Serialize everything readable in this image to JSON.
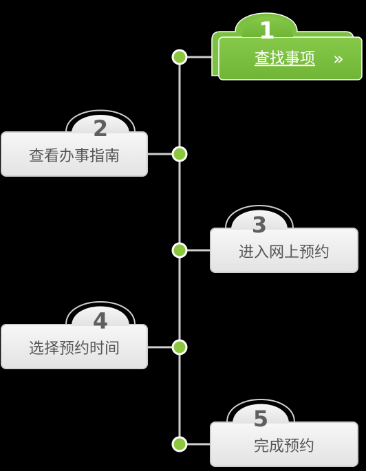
{
  "steps": [
    {
      "number": "1",
      "label": "查找事项",
      "active": true,
      "link": true,
      "arrow": "»"
    },
    {
      "number": "2",
      "label": "查看办事指南",
      "active": false
    },
    {
      "number": "3",
      "label": "进入网上预约",
      "active": false
    },
    {
      "number": "4",
      "label": "选择预约时间",
      "active": false
    },
    {
      "number": "5",
      "label": "完成预约",
      "active": false
    }
  ],
  "colors": {
    "background": "#000000",
    "active_fill": "#7cc13f",
    "active_border": "#6aab32",
    "active_text": "#ffffff",
    "inactive_fill": "#ebebeb",
    "inactive_border": "#cfcfcf",
    "inactive_text": "#555555",
    "number_text": "#5f5f5f",
    "timeline": "#cfcfcf",
    "node_fill": "#8cc63f",
    "node_stroke": "#ffffff"
  }
}
